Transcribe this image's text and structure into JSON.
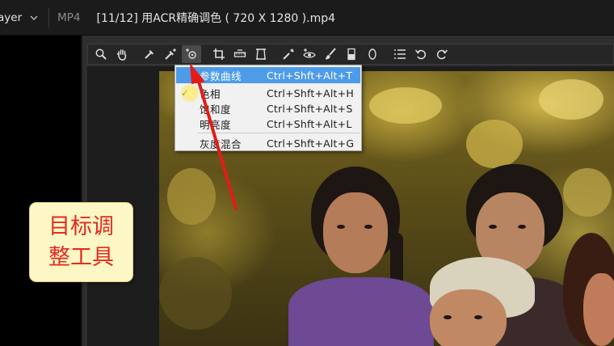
{
  "titlebar": {
    "app_label": "ayer",
    "format": "MP4",
    "file_title": "[11/12] 用ACR精确调色 ( 720 X 1280 ).mp4"
  },
  "toolbar": {
    "tools": [
      {
        "name": "zoom-icon"
      },
      {
        "name": "hand-icon"
      },
      {
        "name": "white-balance-icon"
      },
      {
        "name": "color-sampler-icon"
      },
      {
        "name": "targeted-adjustment-icon",
        "active": true
      },
      {
        "name": "crop-icon"
      },
      {
        "name": "straighten-icon"
      },
      {
        "name": "transform-icon"
      },
      {
        "name": "spot-removal-icon"
      },
      {
        "name": "red-eye-icon"
      },
      {
        "name": "adjustment-brush-icon"
      },
      {
        "name": "graduated-filter-icon"
      },
      {
        "name": "radial-filter-icon"
      },
      {
        "name": "preferences-list-icon"
      },
      {
        "name": "rotate-left-icon"
      },
      {
        "name": "rotate-right-icon"
      }
    ]
  },
  "menu": {
    "items": [
      {
        "label": "参数曲线",
        "shortcut": "Ctrl+Shft+Alt+T",
        "selected": true,
        "checked": false
      },
      {
        "label": "色相",
        "shortcut": "Ctrl+Shft+Alt+H",
        "selected": false,
        "checked": true
      },
      {
        "label": "饱和度",
        "shortcut": "Ctrl+Shft+Alt+S",
        "selected": false,
        "checked": false
      },
      {
        "label": "明亮度",
        "shortcut": "Ctrl+Shft+Alt+L",
        "selected": false,
        "checked": false
      },
      {
        "label": "灰度混合",
        "shortcut": "Ctrl+Shft+Alt+G",
        "selected": false,
        "checked": false
      }
    ],
    "check_glyph": "✓"
  },
  "annotation": {
    "text_line1": "目标调",
    "text_line2": "整工具",
    "text_color": "#e52a22",
    "arrow_color": "#e21d16"
  },
  "colors": {
    "menu_highlight": "#4e9ce8",
    "callout_bg": "#fcf7c4"
  }
}
